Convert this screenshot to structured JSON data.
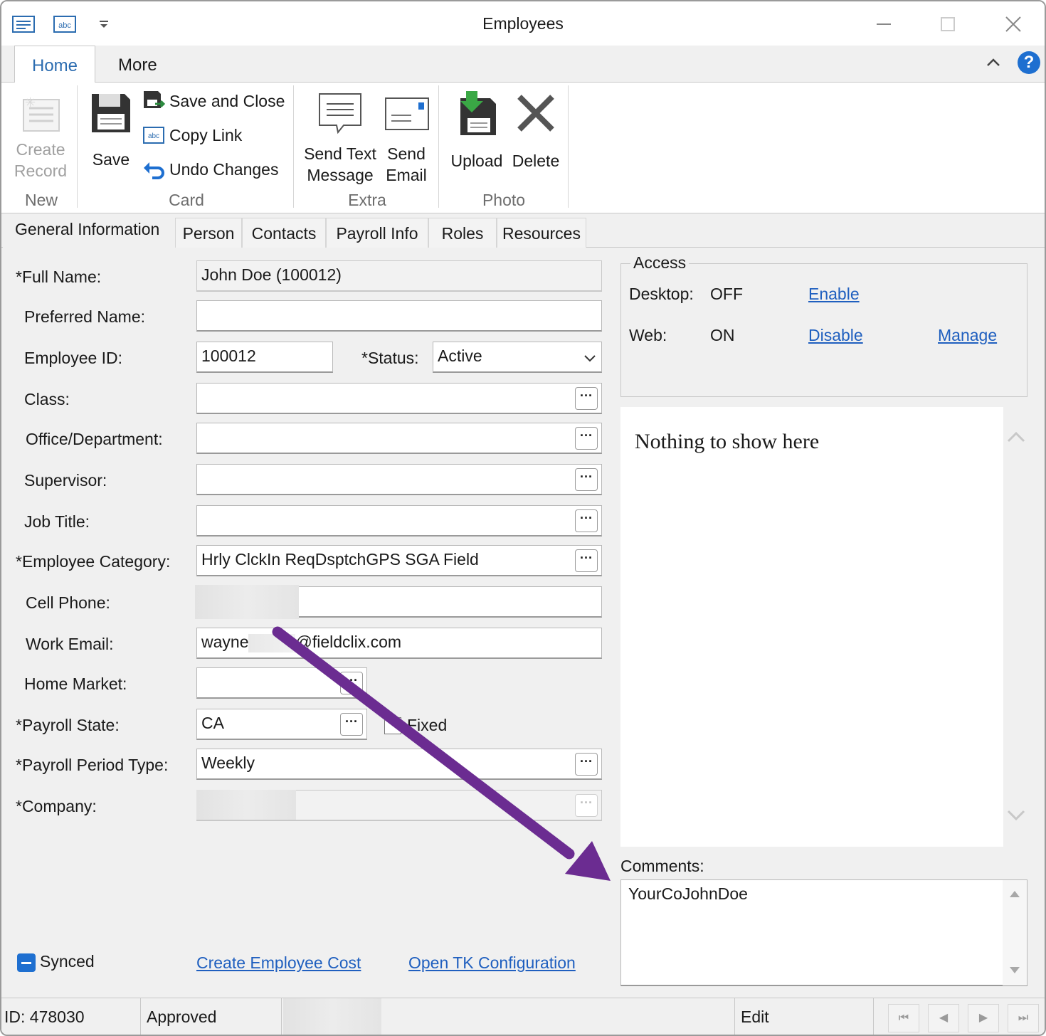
{
  "window": {
    "title": "Employees"
  },
  "ribbon": {
    "tabs": [
      "Home",
      "More"
    ],
    "groups": {
      "new": {
        "label": "New",
        "create_record": [
          "Create",
          "Record"
        ]
      },
      "card": {
        "label": "Card",
        "save": "Save",
        "save_and_close": "Save and Close",
        "copy_link": "Copy Link",
        "undo_changes": "Undo Changes"
      },
      "extra": {
        "label": "Extra",
        "send_text": [
          "Send Text",
          "Message"
        ],
        "send_email": [
          "Send",
          "Email"
        ]
      },
      "photo": {
        "label": "Photo",
        "upload": "Upload",
        "delete": "Delete"
      }
    }
  },
  "form_tabs": [
    "General Information",
    "Person",
    "Contacts",
    "Payroll Info",
    "Roles",
    "Resources"
  ],
  "fields": {
    "full_name": {
      "label": "*Full Name:",
      "value": "John Doe (100012)"
    },
    "preferred_name": {
      "label": "Preferred Name:",
      "value": ""
    },
    "employee_id": {
      "label": "Employee ID:",
      "value": "100012"
    },
    "status": {
      "label": "*Status:",
      "value": "Active"
    },
    "class": {
      "label": "Class:",
      "value": ""
    },
    "office_department": {
      "label": "Office/Department:",
      "value": ""
    },
    "supervisor": {
      "label": "Supervisor:",
      "value": ""
    },
    "job_title": {
      "label": "Job Title:",
      "value": ""
    },
    "employee_category": {
      "label": "*Employee Category:",
      "value": "Hrly ClckIn ReqDsptchGPS SGA Field"
    },
    "cell_phone": {
      "label": "Cell Phone:",
      "value": ""
    },
    "work_email": {
      "label": "Work Email:",
      "value_prefix": "wayne",
      "value_suffix": "@fieldclix.com"
    },
    "home_market": {
      "label": "Home Market:",
      "value": ""
    },
    "payroll_state": {
      "label": "*Payroll State:",
      "value": "CA",
      "fixed_label": "Fixed"
    },
    "payroll_period_type": {
      "label": "*Payroll Period Type:",
      "value": "Weekly"
    },
    "company": {
      "label": "*Company:",
      "value": ""
    }
  },
  "access": {
    "title": "Access",
    "desktop": {
      "label": "Desktop:",
      "state": "OFF",
      "action": "Enable"
    },
    "web": {
      "label": "Web:",
      "state": "ON",
      "action": "Disable",
      "manage": "Manage"
    }
  },
  "preview": {
    "empty_text": "Nothing to show here"
  },
  "comments": {
    "label": "Comments:",
    "value": "YourCoJohnDoe"
  },
  "footer": {
    "synced": "Synced",
    "create_employee_cost": "Create Employee Cost",
    "open_tk_configuration": "Open TK Configuration"
  },
  "statusbar": {
    "id": "ID: 478030",
    "state": "Approved",
    "mode": "Edit"
  },
  "colors": {
    "accent": "#1e6fd0",
    "link": "#1f5fbf",
    "annotation_arrow": "#6b2c91"
  },
  "icons": [
    "window-menu-icon",
    "abc-icon",
    "dropdown-icon",
    "minimize-icon",
    "maximize-icon",
    "close-icon",
    "collapse-ribbon-icon",
    "help-icon",
    "create-record-icon",
    "save-icon",
    "save-and-close-icon",
    "copy-link-icon",
    "undo-icon",
    "send-text-icon",
    "send-email-icon",
    "upload-icon",
    "delete-icon",
    "chevron-down-icon",
    "scroll-up-icon",
    "scroll-down-icon",
    "first-record-icon",
    "previous-record-icon",
    "next-record-icon",
    "last-record-icon"
  ]
}
